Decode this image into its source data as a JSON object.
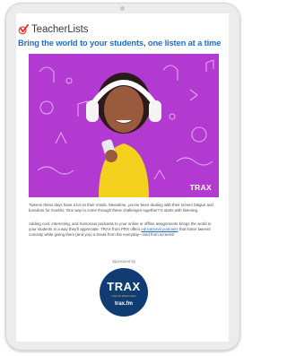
{
  "brand": {
    "name": "TeacherLists",
    "logo_color": "#e0342b"
  },
  "headline": "Bring the world to your students, one listen at a time",
  "hero": {
    "background": "#b23ad1",
    "mark": "TRAX"
  },
  "body": {
    "paragraph1": "Tweens these days have a lot on their minds. Meantime, you've been dealing with their screen fatigue and boredom for months. One way to come through these challenges together? It starts with listening.",
    "paragraph2_before": "Adding cool, interesting, and humorous podcasts to your online or offline assignments brings the world to your students in a way they'll appreciate. TRAX from PRX offers ",
    "paragraph2_link": "educational podcasts",
    "paragraph2_after": " that foster tweens' curiosity while giving them (and you) a break from the everyday—and from screens!"
  },
  "sponsor": {
    "label": "Sponsored by",
    "title": "TRAX",
    "tagline": "Listen for Where's Next",
    "url": "trax.fm",
    "color": "#0f3d73"
  }
}
